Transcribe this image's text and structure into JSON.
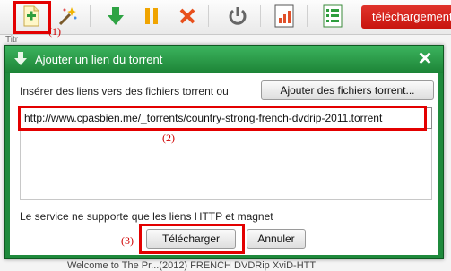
{
  "toolbar": {
    "buttons": [
      {
        "name": "add-link-button",
        "icon": "add-file-icon"
      },
      {
        "name": "wizard-button",
        "icon": "magic-wand-icon"
      },
      {
        "name": "start-button",
        "icon": "download-arrow-icon"
      },
      {
        "name": "pause-button",
        "icon": "pause-icon"
      },
      {
        "name": "delete-button",
        "icon": "close-x-icon"
      },
      {
        "name": "power-button",
        "icon": "power-icon"
      },
      {
        "name": "chart-button",
        "icon": "chart-icon"
      },
      {
        "name": "list-button",
        "icon": "list-icon"
      }
    ],
    "download_label": "téléchargement",
    "accent": "#d0201a"
  },
  "dialog": {
    "title": "Ajouter un lien du torrent",
    "close_icon": "close-icon",
    "instruction": "Insérer  des liens vers des fichiers  torrent ou",
    "add_files_label": "Ajouter des fichiers torrent...",
    "url_value": "http://www.cpasbien.me/_torrents/country-strong-french-dvdrip-2011.torrent",
    "note": "Le service ne supporte que les liens HTTP et magnet",
    "download_label": "Télécharger",
    "cancel_label": "Annuler",
    "title_bar_color": "#1f8a3c"
  },
  "annotations": {
    "label1": "(1)",
    "label2": "(2)",
    "label3": "(3)",
    "color": "#e30000"
  },
  "background": {
    "text": "Welcome to The Pr...(2012) FRENCH DVDRip XviD-HTT",
    "fragment": "Titr"
  }
}
